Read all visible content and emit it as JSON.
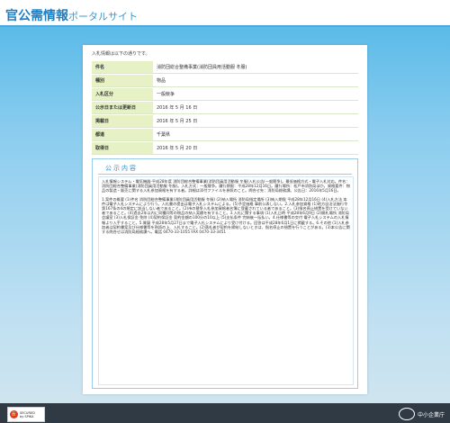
{
  "site": {
    "title": "官公需情報",
    "subtitle": "ポータルサイト"
  },
  "panel": {
    "notice": "入札情報は以下の通りです。",
    "rows": [
      {
        "label": "件名",
        "value": "消防団総合整備事業(消防団員用活動服 冬服)"
      },
      {
        "label": "種別",
        "value": "物品"
      },
      {
        "label": "入札区分",
        "value": "一般競争"
      },
      {
        "label": "公示日または更新日",
        "value": "2016 年 5 月 16 日"
      },
      {
        "label": "掲載日",
        "value": "2016 年 5 月 25 日"
      },
      {
        "label": "都道",
        "value": "千葉県"
      },
      {
        "label": "取得日",
        "value": "2016 年 5 月 20 日"
      }
    ]
  },
  "content": {
    "title": "公示内容",
    "paragraphs": [
      "入札情報システム・電気機器-平成28年度 消防団総合整備事業(消防団員用活動服 冬服)入札公告(一般競争)。最低価格方式・電子入札対応。件名：消防団総合整備事業(消防団員用活動服 冬服)。入札方式：一般競争。履行期限：平成28年12月16日。履行場所：松戸市消防局ほか。資格要件：物品の製造・販売に関する入札参加資格を有する者。詳細は添付ファイルを参照のこと。問合せ先：消防局総務課。公告日：2016年5月16日。",
      "1.案件の概要 (1)件名 消防団総合整備事業(消防団員用活動服 冬服) (2)納入場所 消防局指定場所 (3)納入期限 平成28年12月16日 (4)入札方法 本件は電子入札システムにより行う。入札書の提出は電子入札システムによる。(5)予定価格 事前公表しない。2.入札参加資格 (1)地方自治法施行令第167条の4の規定に該当しない者であること。(2)市の競争入札参加資格者名簿に登載されている者であること。(3)指名停止措置を受けていない者であること。(4)過去2年以内に同種同等の物品の納入実績を有すること。3.入札に関する事項 (1)入札日時 平成28年6月9日 (2)開札場所 消防局会議室 (3)入札保証金 免除 (4)契約保証金 契約金額の100分の10以上 (5)支払条件 完納後一括払い。4.仕様書等の交付 電子入札システムの入札情報より入手すること。5.質疑 平成28年5月27日まで電子入札システムにより受け付ける。回答は平成28年6月1日に掲載する。6.その他 (1)入札参加者は契約書案及び仕様書等を熟読の上、入札すること。(2)落札者が契約を締結しないときは、指名停止の措置を行うことがある。(3)本公告に関する問合せは消防局総務課へ。電話 0470-33-1055 FAX 0470-33-3451"
    ]
  },
  "footer": {
    "badge_line1": "SECURED",
    "badge_line2": "by SPIKA",
    "logo_text": "中小企業庁"
  }
}
